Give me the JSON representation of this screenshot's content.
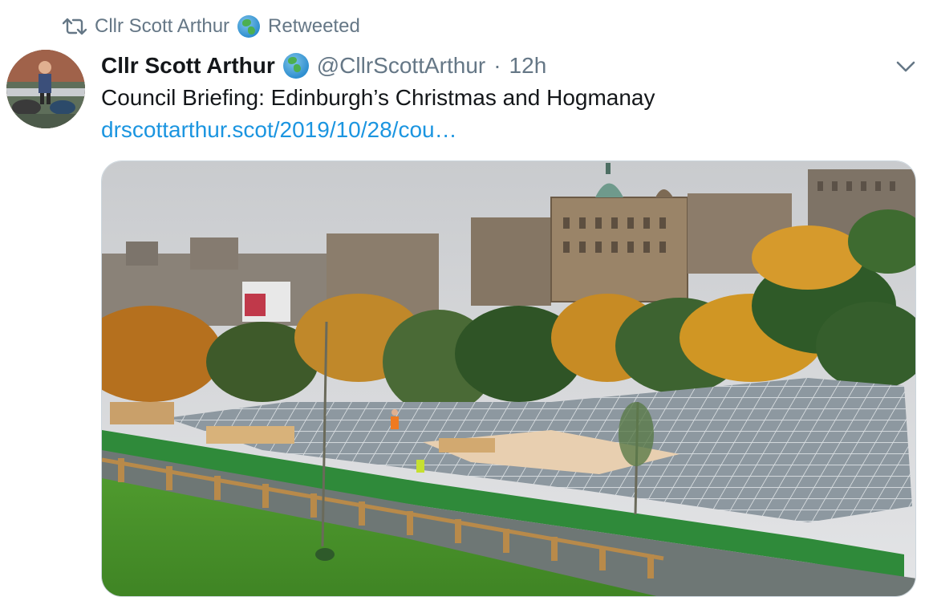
{
  "retweet": {
    "icon": "retweet-icon",
    "retweeter_name": "Cllr Scott Arthur",
    "label": "Retweeted"
  },
  "author": {
    "name": "Cllr Scott Arthur",
    "handle": "@CllrScottArthur",
    "separator": "·",
    "time": "12h"
  },
  "tweet": {
    "text": "Council Briefing: Edinburgh’s Christmas and Hogmanay",
    "link_text": "drscottarthur.scot/2019/10/28/cou…"
  },
  "colors": {
    "link": "#1b95e0",
    "secondary_text": "#657786",
    "primary_text": "#14171a"
  }
}
